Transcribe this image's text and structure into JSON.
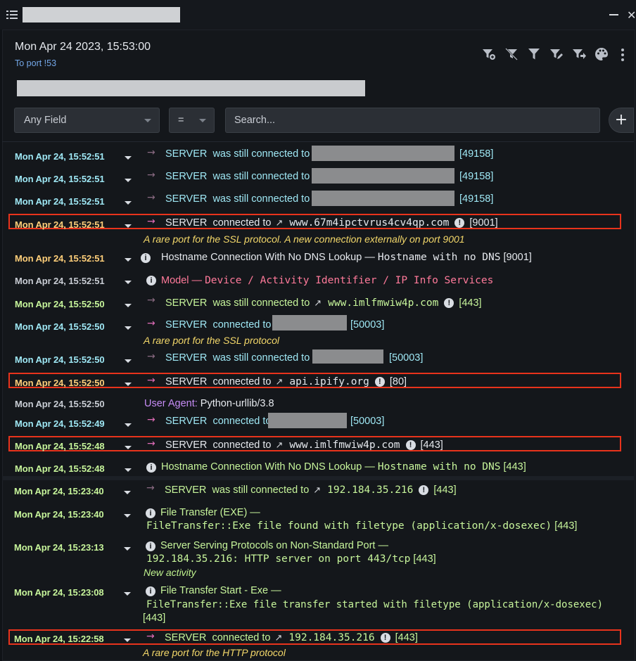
{
  "window": {
    "minimize_label": "–",
    "close_label": "✕"
  },
  "header": {
    "datetime": "Mon Apr 24 2023, 15:53:00",
    "subtitle": "To port !53",
    "toolbar_icons": [
      "filter-add-icon",
      "filter-clear-icon",
      "filter-icon",
      "filter-edit-icon",
      "filter-forward-icon",
      "palette-icon",
      "kebab-menu-icon"
    ]
  },
  "filter": {
    "field_value": "Any Field",
    "operator_value": "=",
    "search_placeholder": "Search...",
    "add_label": "+"
  },
  "events": {
    "r1": {
      "time": "Mon Apr 24, 15:52:51",
      "subject": "SERVER",
      "verb": "was still connected to",
      "port": "[49158]"
    },
    "r2": {
      "time": "Mon Apr 24, 15:52:51",
      "subject": "SERVER",
      "verb": "was still connected to",
      "port": "[49158]"
    },
    "r3": {
      "time": "Mon Apr 24, 15:52:51",
      "subject": "SERVER",
      "verb": "was still connected to",
      "port": "[49158]"
    },
    "r4": {
      "time": "Mon Apr 24, 15:52:51",
      "subject": "SERVER",
      "verb": "connected to",
      "host": "www.67m4ipctvrus4cv4qp.com",
      "port": "[9001]",
      "note": "A rare port for the SSL protocol. A new connection externally on port 9001"
    },
    "r5": {
      "time": "Mon Apr 24, 15:52:51",
      "title": "Hostname Connection With No DNS Lookup —",
      "detail": "Hostname with no DNS",
      "port": "[9001]"
    },
    "r6": {
      "time": "Mon Apr 24, 15:52:51",
      "title": "Model —",
      "detail": "Device / Activity Identifier / IP Info Services"
    },
    "r7": {
      "time": "Mon Apr 24, 15:52:50",
      "subject": "SERVER",
      "verb": "was still connected to",
      "host": "www.imlfmwiw4p.com",
      "port": "[443]"
    },
    "r8": {
      "time": "Mon Apr 24, 15:52:50",
      "subject": "SERVER",
      "verb": "connected to",
      "port": "[50003]",
      "note": "A rare port for the SSL protocol"
    },
    "r9": {
      "time": "Mon Apr 24, 15:52:50",
      "subject": "SERVER",
      "verb": "was still connected to",
      "port": "[50003]"
    },
    "r10": {
      "time": "Mon Apr 24, 15:52:50",
      "subject": "SERVER",
      "verb": "connected to",
      "host": "api.ipify.org",
      "port": "[80]"
    },
    "r11": {
      "time": "Mon Apr 24, 15:52:50",
      "label": "User Agent:",
      "value": "Python-urllib/3.8"
    },
    "r12": {
      "time": "Mon Apr 24, 15:52:49",
      "subject": "SERVER",
      "verb": "connected to",
      "port": "[50003]"
    },
    "r13": {
      "time": "Mon Apr 24, 15:52:48",
      "subject": "SERVER",
      "verb": "connected to",
      "host": "www.imlfmwiw4p.com",
      "port": "[443]"
    },
    "r14": {
      "time": "Mon Apr 24, 15:52:48",
      "title": "Hostname Connection With No DNS Lookup —",
      "detail": "Hostname with no DNS",
      "port": "[443]"
    },
    "r15": {
      "time": "Mon Apr 24, 15:23:40",
      "subject": "SERVER",
      "verb": "was still connected to",
      "host": "192.184.35.216",
      "port": "[443]"
    },
    "r16": {
      "time": "Mon Apr 24, 15:23:40",
      "title": "File Transfer (EXE) —",
      "detail": "FileTransfer::Exe file found with filetype (application/x-dosexec)",
      "port": "[443]"
    },
    "r17": {
      "time": "Mon Apr 24, 15:23:13",
      "title": "Server Serving Protocols on Non-Standard Port —",
      "detail": "192.184.35.216: HTTP server on port 443/tcp",
      "port": "[443]",
      "note": "New activity"
    },
    "r18": {
      "time": "Mon Apr 24, 15:23:08",
      "title": "File Transfer Start - Exe —",
      "detail": "FileTransfer::Exe file transfer started with filetype (application/x-dosexec)",
      "port": "[443]"
    },
    "r19": {
      "time": "Mon Apr 24, 15:22:58",
      "subject": "SERVER",
      "verb": "connected to",
      "host": "192.184.35.216",
      "port": "[443]",
      "note": "A rare port for the HTTP protocol"
    }
  },
  "colors": {
    "highlight_box": "#e8331c",
    "time_cyan": "#9fe8f5",
    "time_green": "#c7f59b",
    "time_orange": "#ffcf7a",
    "note_yellow": "#f4d86a",
    "model_pink": "#ff7a9a"
  }
}
